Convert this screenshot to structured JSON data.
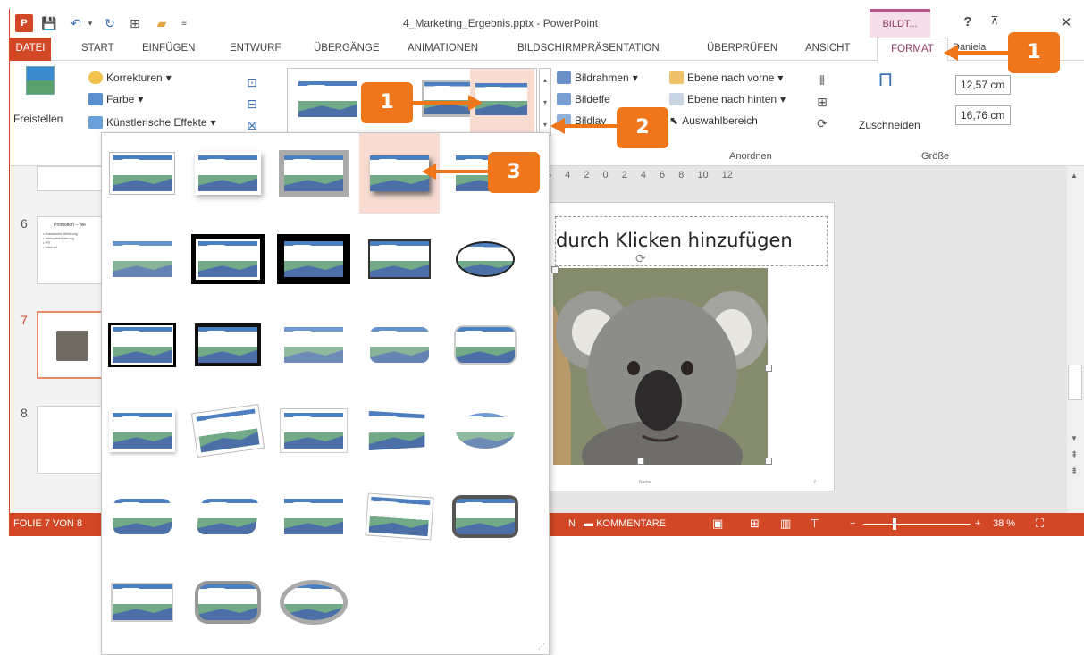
{
  "window": {
    "title": "4_Marketing_Ergebnis.pptx - PowerPoint",
    "context_label": "BILDT...",
    "help": "?",
    "user": "Daniela"
  },
  "tabs": [
    "DATEI",
    "START",
    "EINFÜGEN",
    "ENTWURF",
    "ÜBERGÄNGE",
    "ANIMATIONEN",
    "BILDSCHIRMPRÄSENTATION",
    "ÜBERPRÜFEN",
    "ANSICHT",
    "FORMAT"
  ],
  "ribbon": {
    "freistellen": "Freistellen",
    "korrekturen": "Korrekturen",
    "farbe": "Farbe",
    "kuenstlerisch": "Künstlerische Effekte",
    "bildrahmen": "Bildrahmen",
    "bildeffekte": "Bildeffe",
    "bildlayout": "Bildlay",
    "ebene_vorne": "Ebene nach vorne",
    "ebene_hinten": "Ebene nach hinten",
    "auswahl": "Auswahlbereich",
    "anordnen": "Anordnen",
    "zuschneiden": "Zuschneiden",
    "groesse": "Größe",
    "height": "12,57 cm",
    "width": "16,76 cm"
  },
  "slides": {
    "numbers": [
      "6",
      "7",
      "8"
    ],
    "slide6_title": "Promotion – We",
    "bullets": [
      "• Klassische Werbung",
      "• Verkaufsförderung",
      "• PR",
      "• Internet"
    ]
  },
  "ruler": "6 4 2 0 2 4 6 8 10 12",
  "slide_title": "durch Klicken hinzufügen",
  "slide_footer": "Name",
  "slide_num": "7",
  "status": {
    "folie": "FOLIE 7 VON 8",
    "notizen": "N",
    "kommentare": "KOMMENTARE",
    "zoom": "38 %"
  },
  "callouts": [
    "1",
    "1",
    "2",
    "3"
  ],
  "colors": {
    "accent": "#d24726",
    "callout": "#f0761c",
    "format": "#8a3a66"
  }
}
